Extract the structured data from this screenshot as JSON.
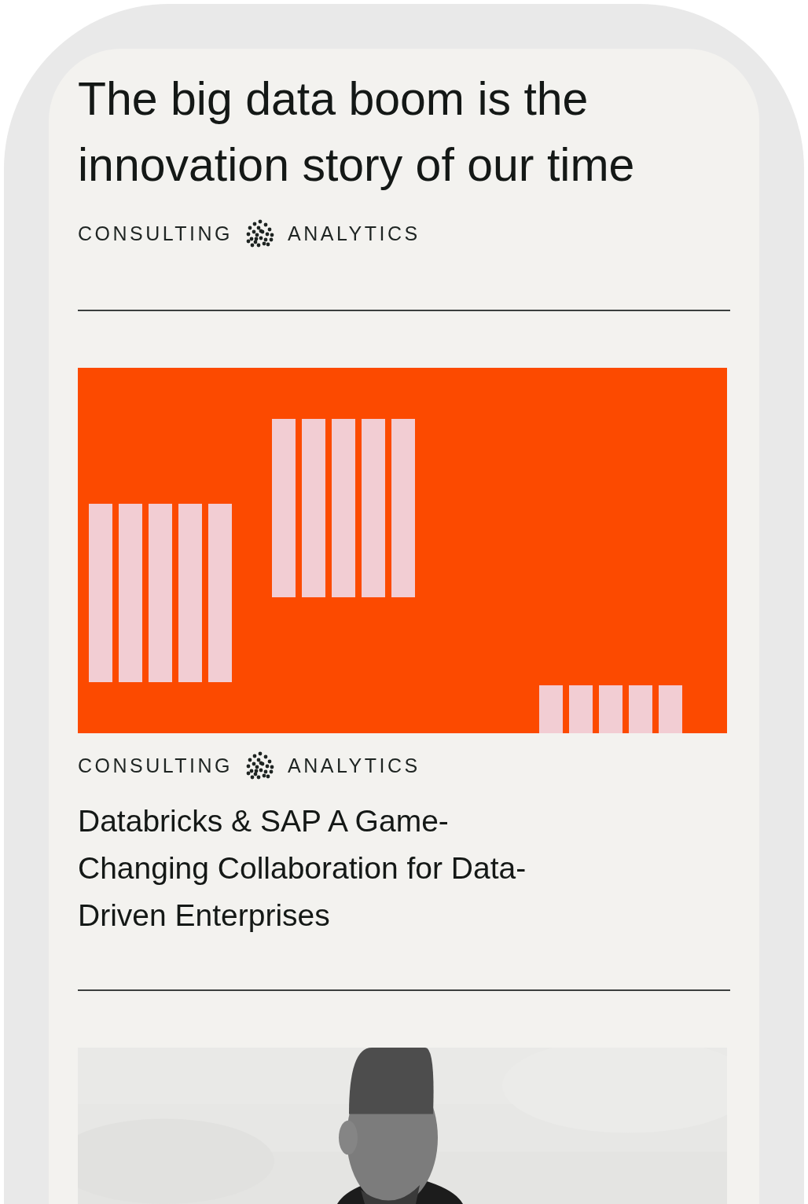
{
  "featured": {
    "title": "The big data boom is the innovation story of our time",
    "tags": [
      "CONSULTING",
      "ANALYTICS"
    ]
  },
  "cards": [
    {
      "media": {
        "kind": "illustration"
      },
      "tags": [
        "CONSULTING",
        "ANALYTICS"
      ],
      "title": "Databricks & SAP A Game-Changing Collaboration for Data-Driven Enterprises"
    },
    {
      "media": {
        "kind": "picture"
      }
    }
  ]
}
